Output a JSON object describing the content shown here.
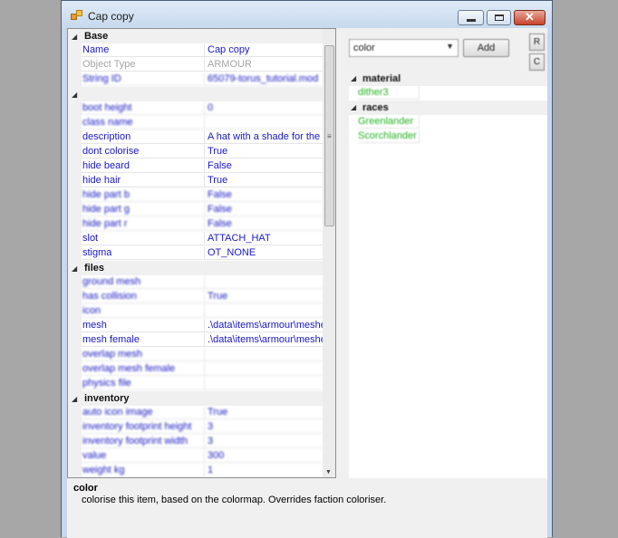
{
  "window": {
    "title": "Cap copy"
  },
  "grid": {
    "rows": [
      {
        "kind": "cat",
        "label": "Base"
      },
      {
        "kind": "prop",
        "name": "Name",
        "value": "Cap copy",
        "style": "normal"
      },
      {
        "kind": "prop",
        "name": "Object Type",
        "value": "ARMOUR",
        "style": "gray"
      },
      {
        "kind": "prop",
        "name": "String ID",
        "value": "65079-torus_tutorial.mod",
        "style": "blur"
      },
      {
        "kind": "cat",
        "label": ""
      },
      {
        "kind": "prop",
        "name": "boot height",
        "value": "0",
        "style": "blur"
      },
      {
        "kind": "prop",
        "name": "class name",
        "value": "",
        "style": "blur"
      },
      {
        "kind": "prop",
        "name": "description",
        "value": "A hat with a shade for the e",
        "style": "normal"
      },
      {
        "kind": "prop",
        "name": "dont colorise",
        "value": "True",
        "style": "normal"
      },
      {
        "kind": "prop",
        "name": "hide beard",
        "value": "False",
        "style": "normal"
      },
      {
        "kind": "prop",
        "name": "hide hair",
        "value": "True",
        "style": "normal"
      },
      {
        "kind": "prop",
        "name": "hide part b",
        "value": "False",
        "style": "blur"
      },
      {
        "kind": "prop",
        "name": "hide part g",
        "value": "False",
        "style": "blur"
      },
      {
        "kind": "prop",
        "name": "hide part r",
        "value": "False",
        "style": "blur"
      },
      {
        "kind": "prop",
        "name": "slot",
        "value": "ATTACH_HAT",
        "style": "normal"
      },
      {
        "kind": "prop",
        "name": "stigma",
        "value": "OT_NONE",
        "style": "normal"
      },
      {
        "kind": "cat",
        "label": "files"
      },
      {
        "kind": "prop",
        "name": "ground mesh",
        "value": "",
        "style": "blur"
      },
      {
        "kind": "prop",
        "name": "has collision",
        "value": "True",
        "style": "blur"
      },
      {
        "kind": "prop",
        "name": "icon",
        "value": "",
        "style": "blur"
      },
      {
        "kind": "prop",
        "name": "mesh",
        "value": ".\\data\\items\\armour\\meshe",
        "style": "normal"
      },
      {
        "kind": "prop",
        "name": "mesh female",
        "value": ".\\data\\items\\armour\\meshe",
        "style": "normal"
      },
      {
        "kind": "prop",
        "name": "overlap mesh",
        "value": "",
        "style": "blur"
      },
      {
        "kind": "prop",
        "name": "overlap mesh female",
        "value": "",
        "style": "blur"
      },
      {
        "kind": "prop",
        "name": "physics file",
        "value": "",
        "style": "blur"
      },
      {
        "kind": "cat",
        "label": "inventory"
      },
      {
        "kind": "prop",
        "name": "auto icon image",
        "value": "True",
        "style": "blur"
      },
      {
        "kind": "prop",
        "name": "inventory footprint height",
        "value": "3",
        "style": "blur"
      },
      {
        "kind": "prop",
        "name": "inventory footprint width",
        "value": "3",
        "style": "blur"
      },
      {
        "kind": "prop",
        "name": "value",
        "value": "300",
        "style": "blur"
      },
      {
        "kind": "prop",
        "name": "weight kg",
        "value": "1",
        "style": "blur"
      }
    ]
  },
  "description": {
    "title": "color",
    "text": "colorise this item, based on the colormap. Overrides faction coloriser."
  },
  "right": {
    "combo_value": "color",
    "add_label": "Add",
    "side_buttons": [
      "R",
      "C"
    ],
    "list": [
      {
        "kind": "cat",
        "label": "material"
      },
      {
        "kind": "item",
        "label": "dither3"
      },
      {
        "kind": "cat",
        "label": "races"
      },
      {
        "kind": "item",
        "label": "Greenlander"
      },
      {
        "kind": "item",
        "label": "Scorchlander"
      }
    ]
  },
  "colors": {
    "property_text": "#1818c0",
    "reference_text": "#24b324",
    "disabled_text": "#a5a5a5"
  }
}
